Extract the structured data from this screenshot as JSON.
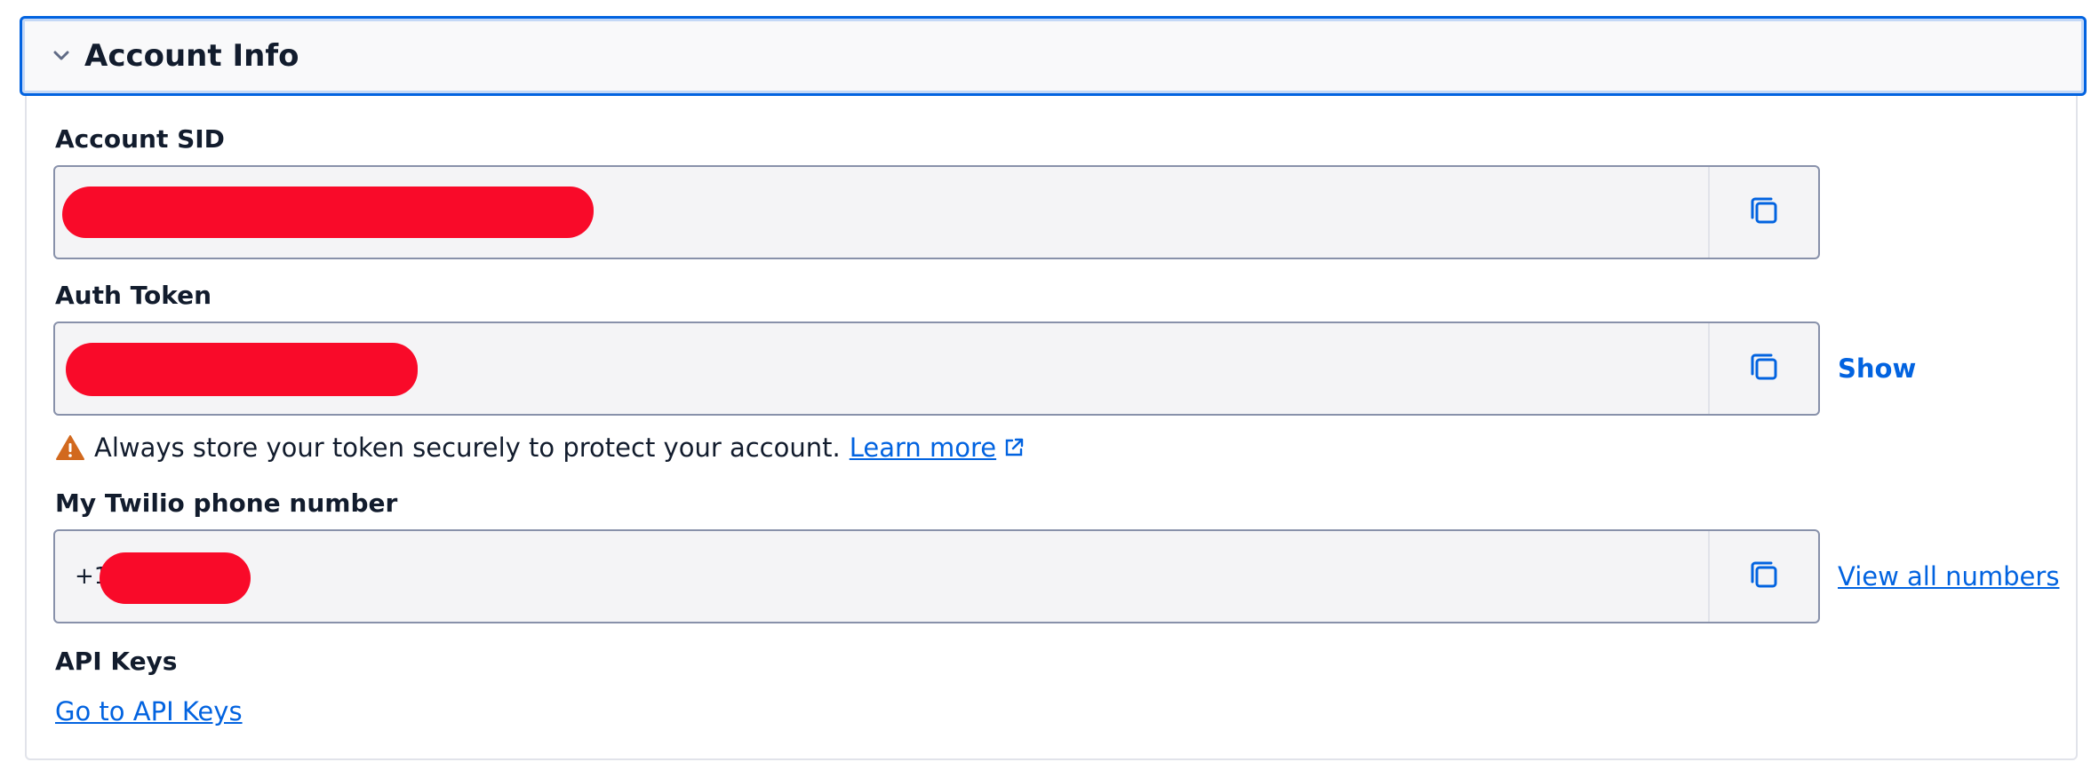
{
  "panel": {
    "title": "Account Info",
    "chevron_icon": "chevron-down-icon"
  },
  "account_sid": {
    "label": "Account SID",
    "value": ""
  },
  "auth_token": {
    "label": "Auth Token",
    "value": "",
    "show_label": "Show"
  },
  "warning": {
    "icon": "warning-triangle-icon",
    "text": "Always store your token securely to protect your account.",
    "link_label": "Learn more",
    "link_icon": "external-link-icon"
  },
  "phone": {
    "label": "My Twilio phone number",
    "prefix": "+1",
    "view_all_label": "View all numbers"
  },
  "api_keys": {
    "label": "API Keys",
    "link_label": "Go to API Keys"
  },
  "colors": {
    "accent": "#0263e0",
    "focus_border": "#0263e0",
    "warning": "#d2691e",
    "redaction": "#f90a29",
    "field_bg": "#f4f4f6"
  }
}
